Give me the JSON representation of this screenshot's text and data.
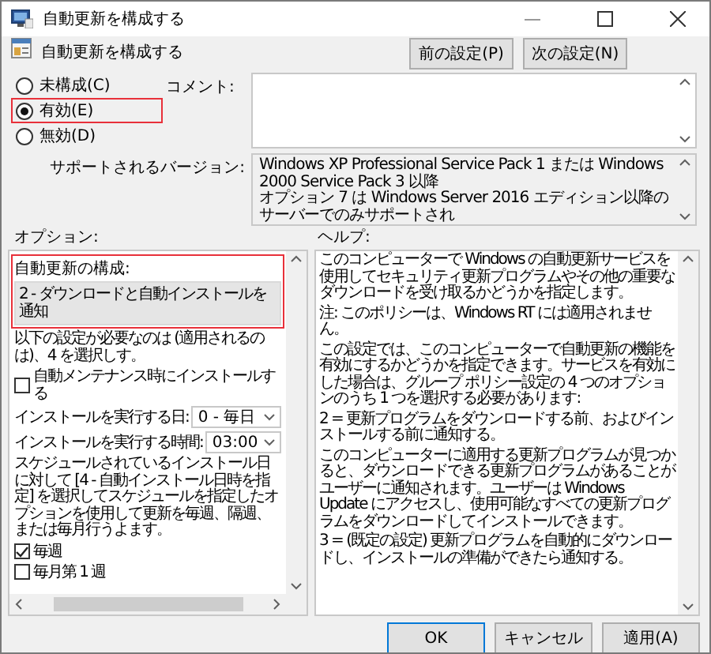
{
  "window": {
    "title": "自動更新を構成する"
  },
  "header": {
    "title": "自動更新を構成する",
    "buttons": [
      {
        "label": "前の設定(P)"
      },
      {
        "label": "次の設定(N)"
      }
    ]
  },
  "state_options": [
    {
      "label": "未構成(C)",
      "selected": false,
      "highlighted": false
    },
    {
      "label": "有効(E)",
      "selected": true,
      "highlighted": true
    },
    {
      "label": "無効(D)",
      "selected": false,
      "highlighted": false
    }
  ],
  "comment": {
    "label": "コメント:"
  },
  "supported": {
    "label": "サポートされるバージョン:",
    "lines": [
      "Windows XP Professional Service Pack 1 または Windows 2000 Service Pack 3 以降",
      "オプション 7 は Windows Server 2016 エディション以降のサーバーでのみサポートされ"
    ]
  },
  "options": {
    "label": "オプション:",
    "configure": {
      "label": "自動更新の構成:",
      "value": "2 - ダウンロードと自動インストールを通知",
      "highlighted": true
    },
    "items": [
      {
        "kind": "text",
        "text": "以下の設定が必要なのは (適用されるのは)、4 を選択しす。"
      },
      {
        "kind": "checkbox",
        "label": "自動メンテナンス時にインストールする",
        "checked": false
      },
      {
        "kind": "select",
        "label": "インストールを実行する日:",
        "value": "0 - 毎日"
      },
      {
        "kind": "select",
        "label": "インストールを実行する時間:",
        "value": "03:00"
      },
      {
        "kind": "text",
        "text": "スケジュールされているインストール日に対して [4 - 自動インストール日時を指定] を選択してスケジュールを指定したオプションを使用して更新を毎週、隔週、または毎月行うよます。"
      },
      {
        "kind": "checkbox",
        "label": "毎週",
        "checked": true
      },
      {
        "kind": "checkbox",
        "label": "毎月第 1 週",
        "checked": false
      }
    ]
  },
  "help": {
    "label": "ヘルプ:",
    "paragraphs": [
      "このコンピューターで Windows の自動更新サービスを使用してセキュリティ更新プログラムやその他の重要なダウンロードを受け取るかどうかを指定します。",
      "注: このポリシーは、Windows RT には適用されません。",
      "この設定では、このコンピューターで自動更新の機能を有効にするかどうかを指定できます。サービスを有効にした場合は、グループ ポリシー設定の 4 つのオプションのうち 1 つを選択する必要があります:",
      "2 = 更新プログラムをダウンロードする前、およびインストールする前に通知する。",
      "このコンピューターに適用する更新プログラムが見つかると、ダウンロードできる更新プログラムがあることがユーザーに通知されます。ユーザーは Windows Update にアクセスし、使用可能なすべての更新プログラムをダウンロードしてインストールできます。",
      "3 = (既定の設定) 更新プログラムを自動的にダウンロードし、インストールの準備ができたら通知する。"
    ]
  },
  "footer_buttons": [
    {
      "label": "OK",
      "default": true
    },
    {
      "label": "キャンセル",
      "default": false
    },
    {
      "label": "適用(A)",
      "default": false
    }
  ]
}
